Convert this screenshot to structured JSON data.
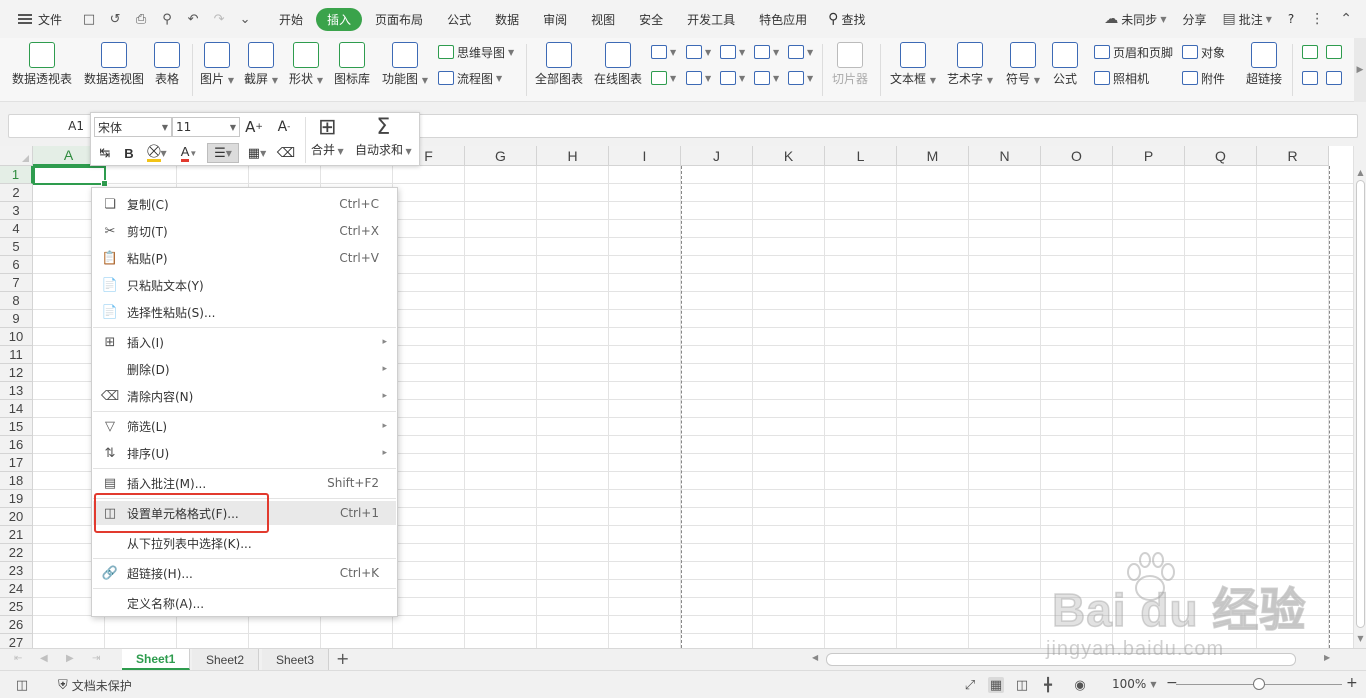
{
  "menubar": {
    "file": "文件",
    "tabs": [
      "开始",
      "插入",
      "页面布局",
      "公式",
      "数据",
      "审阅",
      "视图",
      "安全",
      "开发工具",
      "特色应用"
    ],
    "active_tab": "插入",
    "search": "查找",
    "sync": "未同步",
    "share": "分享",
    "comment": "批注",
    "help": "?",
    "icons": [
      "hamburger-menu-icon",
      "save-icon",
      "undo-icon",
      "print-icon",
      "print-preview-icon",
      "redo-icon",
      "customize-icon"
    ]
  },
  "ribbon": {
    "pivot_table": "数据透视表",
    "pivot_chart": "数据透视图",
    "table": "表格",
    "picture": "图片",
    "screenshot": "截屏",
    "shape": "形状",
    "icon_lib": "图标库",
    "function_chart": "功能图",
    "mindmap": "思维导图",
    "flowchart": "流程图",
    "all_charts": "全部图表",
    "online_chart": "在线图表",
    "slicer": "切片器",
    "textbox": "文本框",
    "wordart": "艺术字",
    "symbol": "符号",
    "formula": "公式",
    "header_footer": "页眉和页脚",
    "camera": "照相机",
    "object": "对象",
    "attachment": "附件",
    "hyperlink": "超链接"
  },
  "formula_bar": {
    "name_box": "A1"
  },
  "mini_toolbar": {
    "font": "宋体",
    "size": "11",
    "merge": "合并",
    "autosum": "自动求和"
  },
  "grid": {
    "columns": [
      "A",
      "B",
      "C",
      "D",
      "E",
      "F",
      "G",
      "H",
      "I",
      "J",
      "K",
      "L",
      "M",
      "N",
      "O",
      "P",
      "Q",
      "R"
    ],
    "rows": [
      "1",
      "2",
      "3",
      "4",
      "5",
      "6",
      "7",
      "8",
      "9",
      "10",
      "11",
      "12",
      "13",
      "14",
      "15",
      "16",
      "17",
      "18",
      "19",
      "20",
      "21",
      "22",
      "23",
      "24",
      "25",
      "26",
      "27"
    ],
    "selected_cell": "A1"
  },
  "context_menu": {
    "items": [
      {
        "label": "复制(C)",
        "shortcut": "Ctrl+C"
      },
      {
        "label": "剪切(T)",
        "shortcut": "Ctrl+X"
      },
      {
        "label": "粘贴(P)",
        "shortcut": "Ctrl+V"
      },
      {
        "label": "只粘贴文本(Y)",
        "shortcut": ""
      },
      {
        "label": "选择性粘贴(S)...",
        "shortcut": ""
      },
      {
        "label": "插入(I)",
        "shortcut": ""
      },
      {
        "label": "删除(D)",
        "shortcut": ""
      },
      {
        "label": "清除内容(N)",
        "shortcut": ""
      },
      {
        "label": "筛选(L)",
        "shortcut": ""
      },
      {
        "label": "排序(U)",
        "shortcut": ""
      },
      {
        "label": "插入批注(M)...",
        "shortcut": "Shift+F2"
      },
      {
        "label": "设置单元格格式(F)...",
        "shortcut": "Ctrl+1"
      },
      {
        "label": "从下拉列表中选择(K)...",
        "shortcut": ""
      },
      {
        "label": "超链接(H)...",
        "shortcut": "Ctrl+K"
      },
      {
        "label": "定义名称(A)...",
        "shortcut": ""
      }
    ],
    "highlighted": "设置单元格格式(F)..."
  },
  "sheets": {
    "tabs": [
      "Sheet1",
      "Sheet2",
      "Sheet3"
    ],
    "active": "Sheet1",
    "add": "+"
  },
  "statusbar": {
    "protect": "文档未保护",
    "zoom": "100%"
  },
  "watermark": {
    "brand": "Bai du 经验",
    "url": "jingyan.baidu.com"
  },
  "colors": {
    "accent": "#3aa34b",
    "selection": "#2e9c4e",
    "annotation_red": "#e23a2e"
  }
}
